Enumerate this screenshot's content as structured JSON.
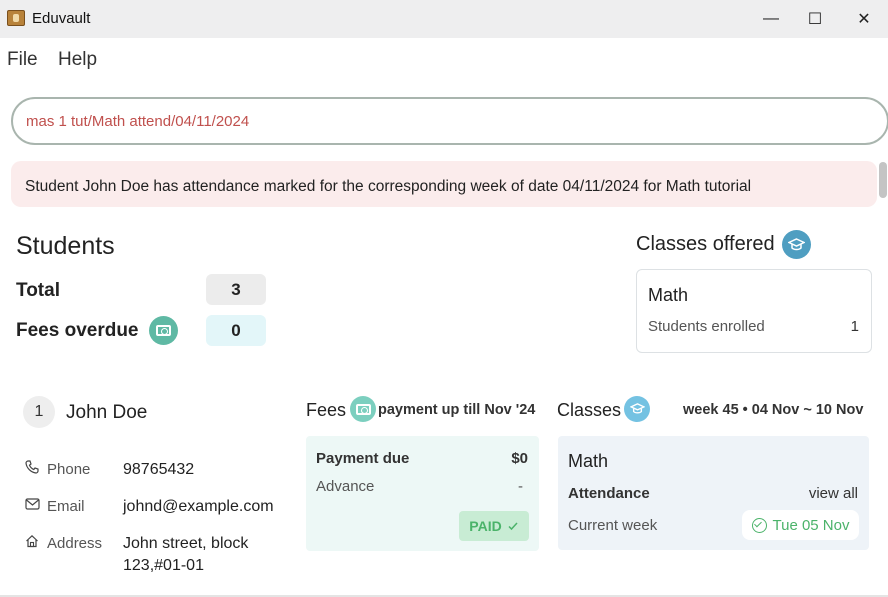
{
  "window": {
    "title": "Eduvault",
    "minimize": "—",
    "maximize": "☐",
    "close": "✕"
  },
  "menu": {
    "file": "File",
    "help": "Help"
  },
  "command": {
    "value": "mas 1 tut/Math attend/04/11/2024"
  },
  "result": {
    "text": "Student John Doe has attendance marked for the corresponding week of date 04/11/2024 for Math tutorial"
  },
  "students": {
    "heading": "Students",
    "total_label": "Total",
    "total_value": "3",
    "fees_overdue_label": "Fees overdue",
    "fees_overdue_value": "0"
  },
  "classes_offered": {
    "heading": "Classes offered",
    "items": [
      {
        "name": "Math",
        "label": "Students enrolled",
        "count": "1"
      }
    ]
  },
  "student_card": {
    "index": "1",
    "name": "John Doe",
    "phone_label": "Phone",
    "phone": "98765432",
    "email_label": "Email",
    "email": "johnd@example.com",
    "address_label": "Address",
    "address_line1": "John street, block",
    "address_line2": "123,#01-01"
  },
  "fees": {
    "title": "Fees",
    "subtitle": "payment up till Nov '24",
    "payment_due_label": "Payment due",
    "payment_due_value": "$0",
    "advance_label": "Advance",
    "advance_value": "-",
    "status": "PAID"
  },
  "classes": {
    "title": "Classes",
    "week": "week 45 • 04 Nov ~ 10 Nov",
    "class_name": "Math",
    "attendance_label": "Attendance",
    "view_all": "view all",
    "current_week_label": "Current week",
    "current_week_date": "Tue 05 Nov"
  },
  "colors": {
    "error_text": "#c0504d",
    "result_bg": "#fbecec",
    "paid_green": "#4bb36a"
  },
  "icons": [
    "app-icon",
    "money-icon",
    "graduation-cap-icon",
    "phone-icon",
    "email-icon",
    "home-icon",
    "check-circle-icon"
  ]
}
